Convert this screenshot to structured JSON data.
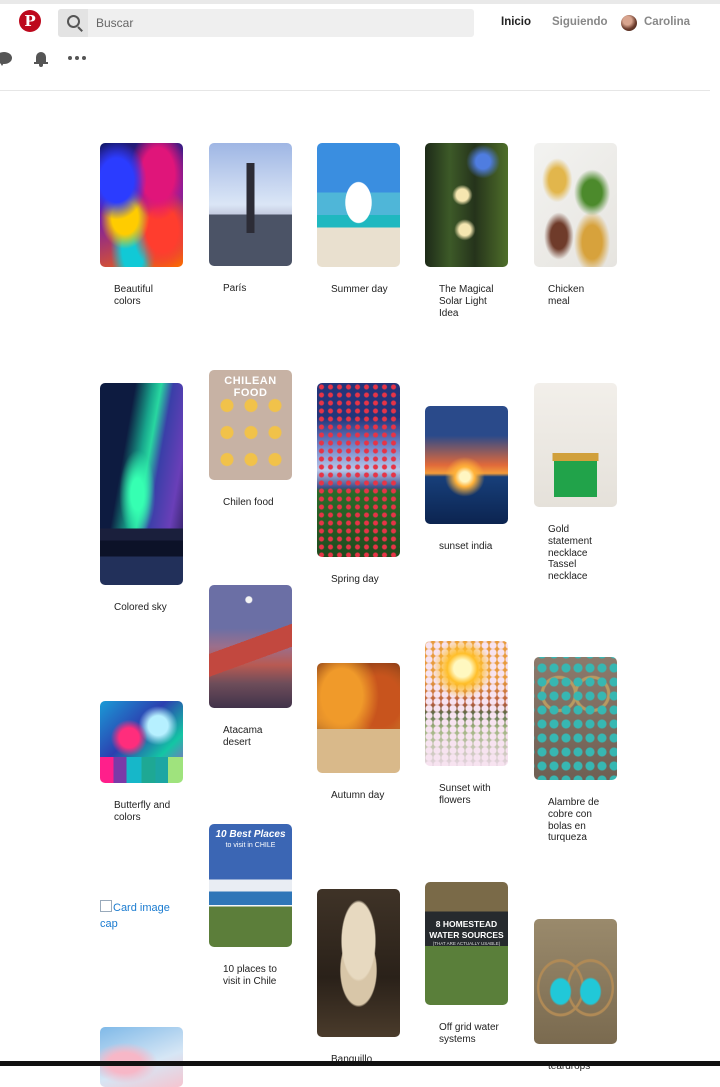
{
  "header": {
    "logo_letter": "P",
    "search_placeholder": "Buscar",
    "nav_home": "Inicio",
    "nav_following": "Siguiendo",
    "nav_user": "Carolina"
  },
  "icons": [
    "pinterest-logo",
    "search-icon",
    "chat-icon",
    "bell-icon",
    "more-icon",
    "avatar"
  ],
  "colors": {
    "brand": "#bd081c",
    "link": "#1a7bd0"
  },
  "broken_image_text": "Card image cap",
  "pins": [
    {
      "title": "Beautiful colors"
    },
    {
      "title": "París"
    },
    {
      "title": "Summer day"
    },
    {
      "title": "The Magical Solar Light Idea"
    },
    {
      "title": "Chicken meal"
    },
    {
      "title": "Colored sky"
    },
    {
      "title": "Chilen food"
    },
    {
      "title": "Spring day"
    },
    {
      "title": "sunset india"
    },
    {
      "title": "Gold statement necklace Tassel necklace"
    },
    {
      "title": "Atacama desert"
    },
    {
      "title": "Butterfly and colors"
    },
    {
      "title": "Autumn day"
    },
    {
      "title": "Sunset with flowers"
    },
    {
      "title": "Alambre de cobre con bolas en turqueza"
    },
    {
      "title": "10 places to visit in Chile"
    },
    {
      "title": "Banquillo"
    },
    {
      "title": "Off grid water systems"
    },
    {
      "title": "teardrops"
    },
    {
      "title": ""
    }
  ],
  "pin_image_text": {
    "chilean_food": "CHILEAN FOOD",
    "chile_places_line1": "10 Best Places",
    "chile_places_line2": "to visit in CHILE",
    "homestead_line1": "8 HOMESTEAD",
    "homestead_line2": "WATER SOURCES",
    "homestead_line3": "(THAT ARE ACTUALLY USABLE)"
  }
}
